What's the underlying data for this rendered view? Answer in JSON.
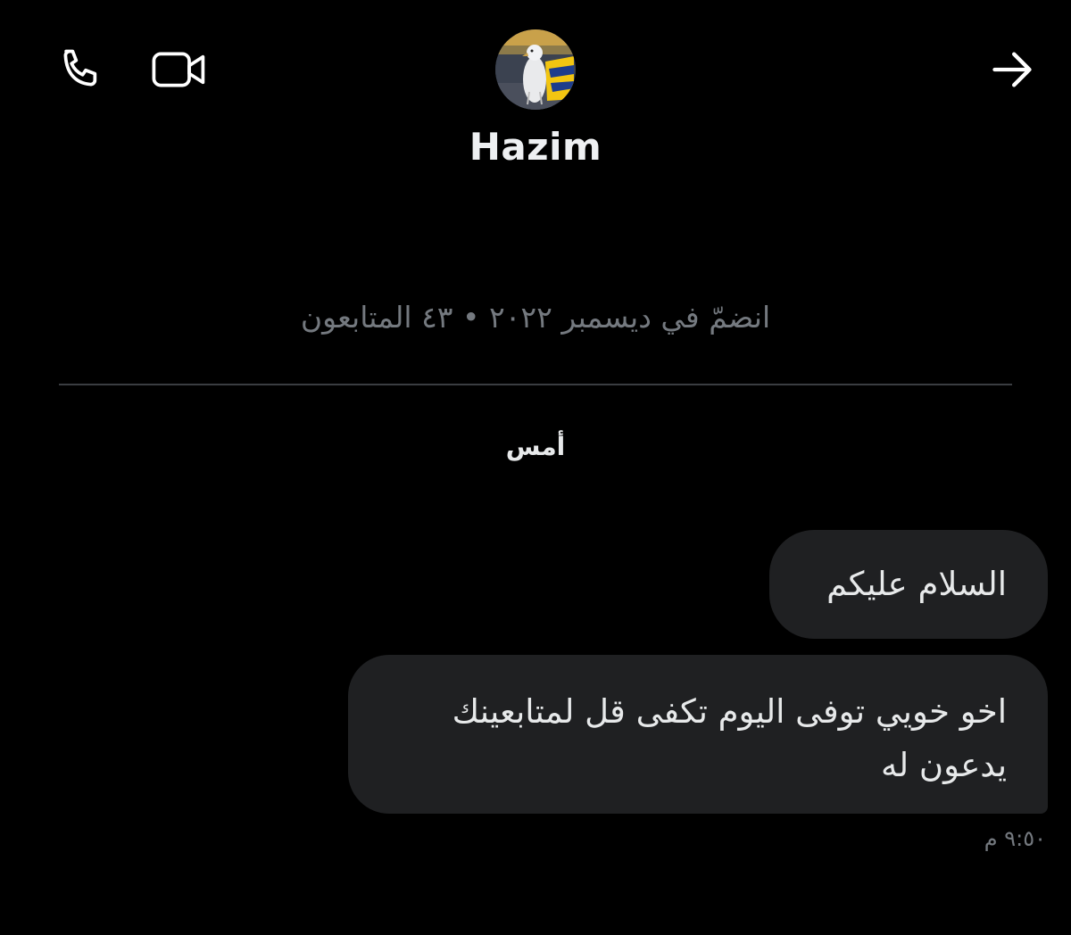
{
  "header": {
    "username": "Hazim",
    "icons": {
      "call": "phone-icon",
      "video": "video-camera-icon",
      "back": "arrow-right-icon"
    }
  },
  "profile": {
    "meta": "انضمّ في ديسمبر ٢٠٢٢ • ٤٣ المتابعون"
  },
  "conversation": {
    "day_label": "أمس",
    "messages": [
      {
        "text": "السلام عليكم"
      },
      {
        "text": "اخو خويي توفى اليوم تكفى قل لمتابعينك يدعون له"
      }
    ],
    "timestamp": "٩:٥٠ م"
  },
  "colors": {
    "background": "#000000",
    "bubble": "#1f2022",
    "text": "#e7e9ea",
    "muted": "#74797f",
    "accent_blue": "#1d3c8c",
    "accent_yellow": "#f2c511"
  }
}
